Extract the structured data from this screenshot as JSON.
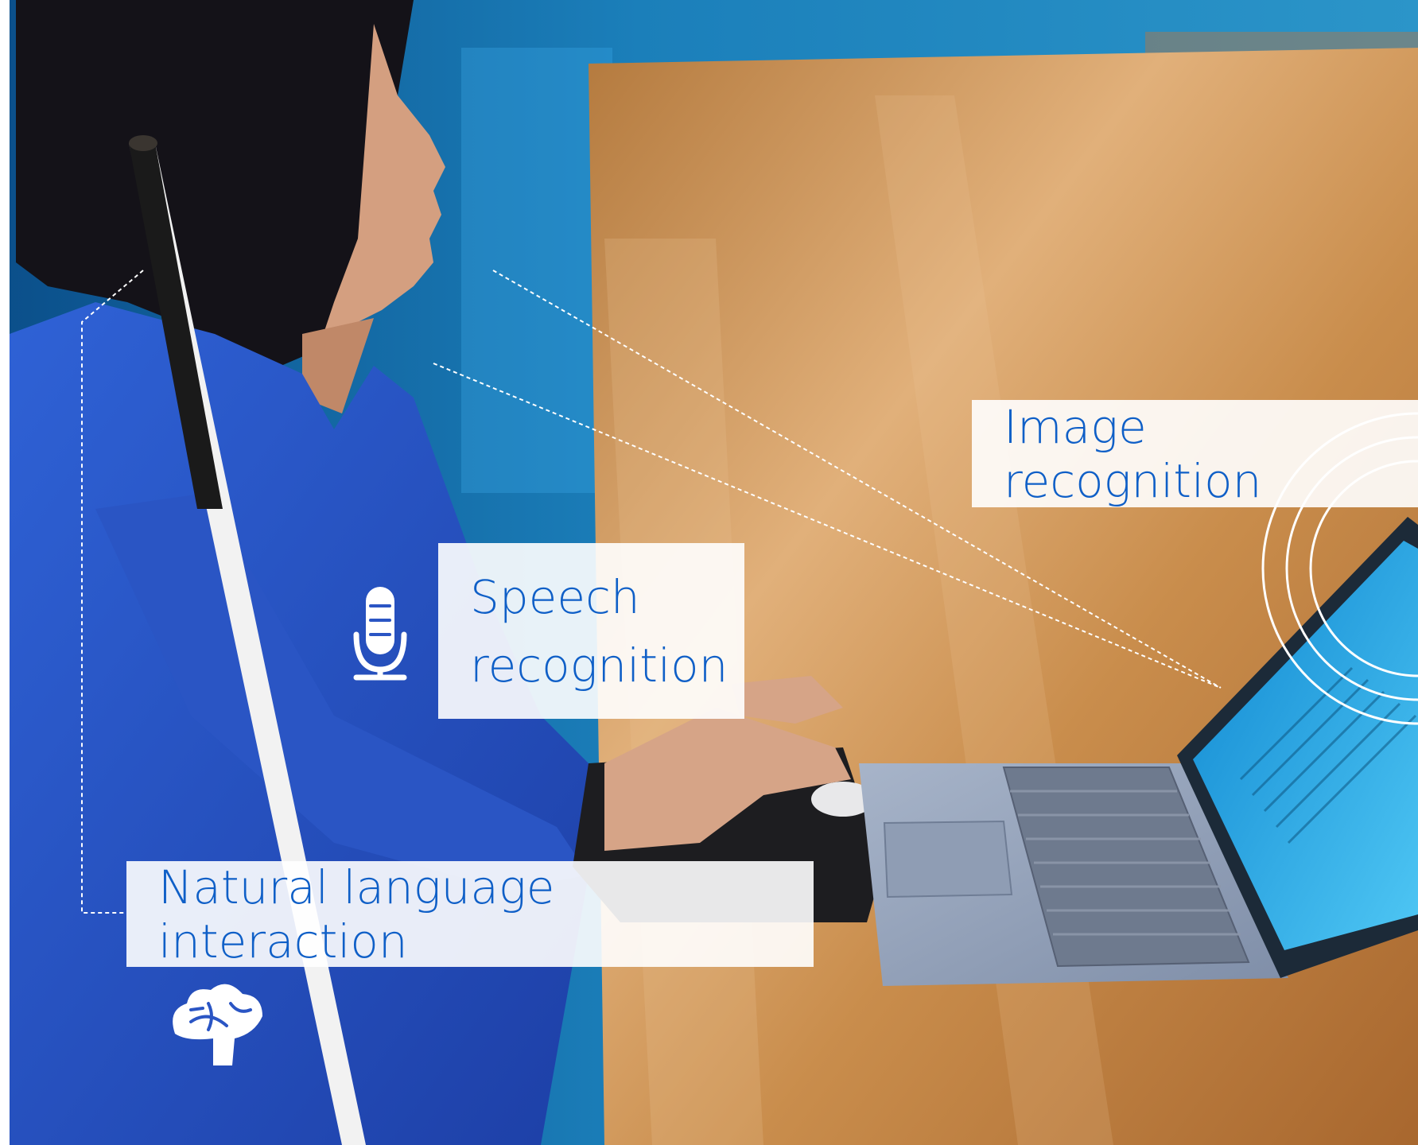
{
  "labels": {
    "image_recognition": "Image recognition",
    "speech_recognition_line1": "Speech",
    "speech_recognition_line2": "recognition",
    "natural_language": "Natural language interaction"
  },
  "icons": {
    "microphone": "microphone-icon",
    "brain": "brain-icon",
    "signal": "radio-waves-icon"
  },
  "colors": {
    "label_text": "#0f5fc7",
    "sweater": "#2e59c8",
    "table_wood": "#c98d4c",
    "laptop_screen": "#1fa6e6"
  }
}
